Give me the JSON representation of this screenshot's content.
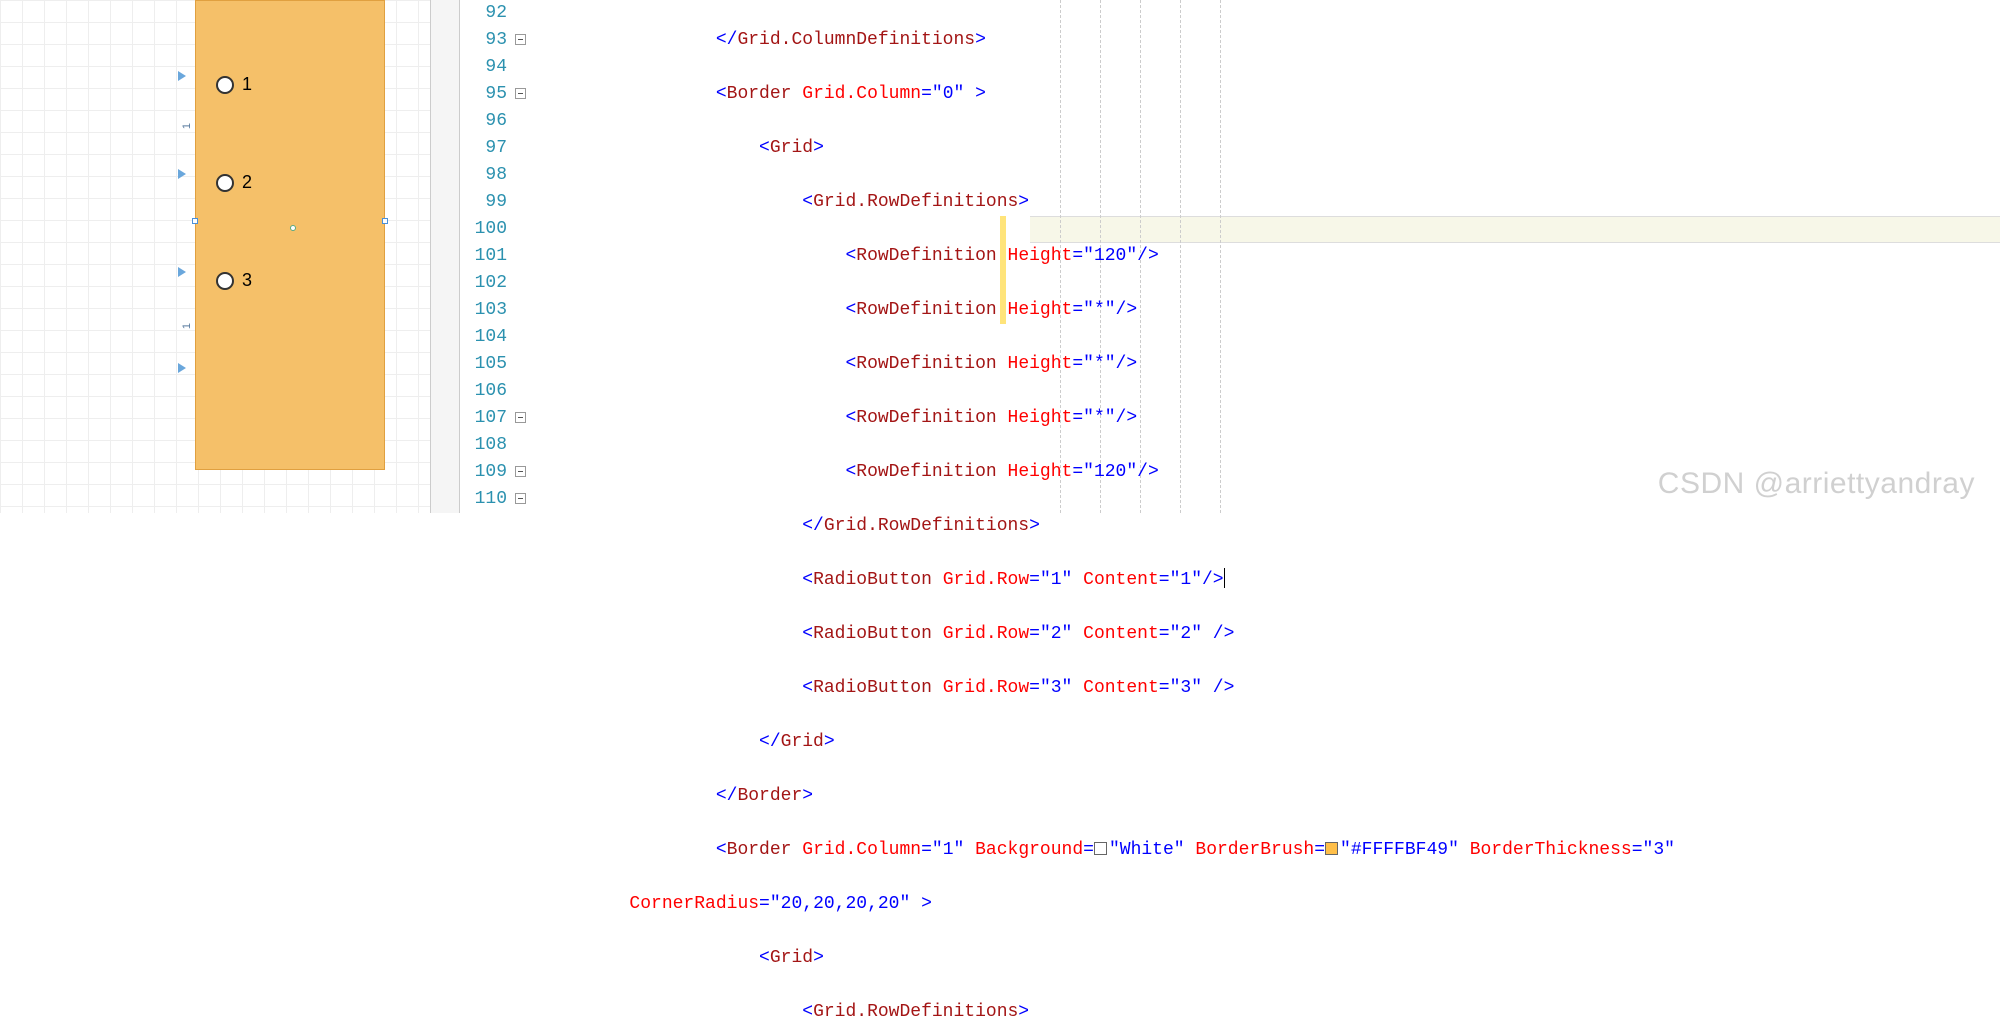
{
  "designer": {
    "radios": [
      "1",
      "2",
      "3"
    ],
    "ruler_labels": [
      "1",
      "1"
    ]
  },
  "line_numbers": [
    "92",
    "93",
    "94",
    "95",
    "96",
    "97",
    "98",
    "99",
    "100",
    "101",
    "102",
    "103",
    "104",
    "105",
    "106",
    "107",
    "108",
    "109",
    "110"
  ],
  "code": {
    "l92": {
      "tag_close": "</",
      "tag": "Grid.ColumnDefinitions",
      "end": ">"
    },
    "l93": {
      "open": "<",
      "tag": "Border",
      "attr": "Grid.Column",
      "eq": "=",
      "val": "\"0\"",
      "end": " >"
    },
    "l94": {
      "open": "<",
      "tag": "Grid",
      "end": ">"
    },
    "l95": {
      "open": "<",
      "tag": "Grid.RowDefinitions",
      "end": ">"
    },
    "l96": {
      "open": "<",
      "tag": "RowDefinition",
      "attr": "Height",
      "eq": "=",
      "val": "\"120\"",
      "end": "/>"
    },
    "l97": {
      "open": "<",
      "tag": "RowDefinition",
      "attr": "Height",
      "eq": "=",
      "val": "\"*\"",
      "end": "/>"
    },
    "l98": {
      "open": "<",
      "tag": "RowDefinition",
      "attr": "Height",
      "eq": "=",
      "val": "\"*\"",
      "end": "/>"
    },
    "l99": {
      "open": "<",
      "tag": "RowDefinition",
      "attr": "Height",
      "eq": "=",
      "val": "\"*\"",
      "end": "/>"
    },
    "l100": {
      "open": "<",
      "tag": "RowDefinition",
      "attr": "Height",
      "eq": "=",
      "val": "\"120\"",
      "end": "/>"
    },
    "l101": {
      "tag_close": "</",
      "tag": "Grid.RowDefinitions",
      "end": ">"
    },
    "l102": {
      "open": "<",
      "tag": "RadioButton",
      "attr1": "Grid.Row",
      "val1": "\"1\"",
      "attr2": "Content",
      "val2": "\"1\"",
      "end": "/>"
    },
    "l103": {
      "open": "<",
      "tag": "RadioButton",
      "attr1": "Grid.Row",
      "val1": "\"2\"",
      "attr2": "Content",
      "val2": "\"2\"",
      "end": " />"
    },
    "l104": {
      "open": "<",
      "tag": "RadioButton",
      "attr1": "Grid.Row",
      "val1": "\"3\"",
      "attr2": "Content",
      "val2": "\"3\"",
      "end": " />"
    },
    "l105": {
      "tag_close": "</",
      "tag": "Grid",
      "end": ">"
    },
    "l106": {
      "tag_close": "</",
      "tag": "Border",
      "end": ">"
    },
    "l107": {
      "open": "<",
      "tag": "Border",
      "attr1": "Grid.Column",
      "val1": "\"1\"",
      "attr2": "Background",
      "val2": "\"White\"",
      "attr3": "BorderBrush",
      "val3": "\"#FFFFBF49\"",
      "attr4": "BorderThickness",
      "val4": "\"3\""
    },
    "l108": {
      "attr": "CornerRadius",
      "eq": "=",
      "val": "\"20,20,20,20\"",
      "end": " >"
    },
    "l109": {
      "open": "<",
      "tag": "Grid",
      "end": ">"
    },
    "l110": {
      "open": "<",
      "tag": "Grid.RowDefinitions",
      "end": ">"
    }
  },
  "watermark": "CSDN @arriettyandray",
  "colors": {
    "orange_panel": "#f5c069",
    "border_brush": "#FFFFBF49"
  }
}
